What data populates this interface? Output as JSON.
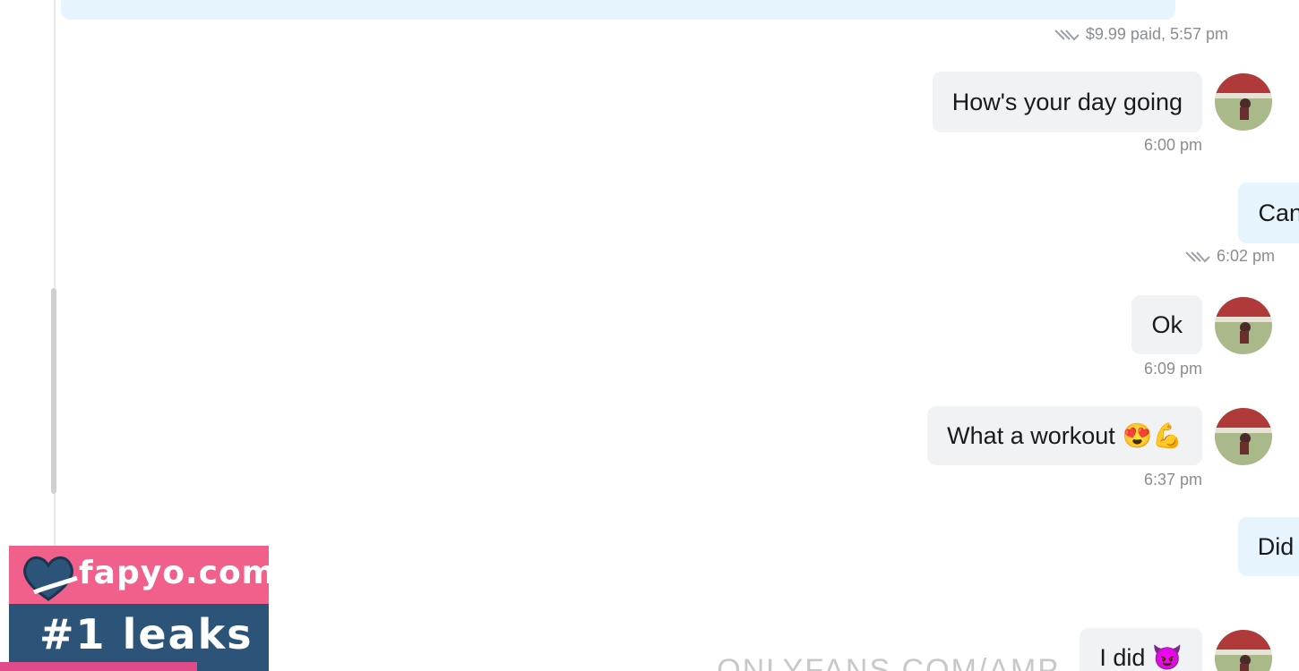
{
  "messages": [
    {
      "id": "m0",
      "side": "out",
      "text": "",
      "time": "$9.99 paid, 5:57 pm"
    },
    {
      "id": "m1",
      "side": "in",
      "text": "How's your day going",
      "time": "6:00 pm"
    },
    {
      "id": "m2",
      "side": "out",
      "text": "Can't wait for you to see this new video!",
      "emoji": "👆",
      "time": "6:02 pm"
    },
    {
      "id": "m3",
      "side": "in",
      "text": "Ok",
      "time": "6:09 pm"
    },
    {
      "id": "m4",
      "side": "in",
      "text": "What a workout",
      "emoji": "😍💪",
      "time": "6:37 pm"
    },
    {
      "id": "m5",
      "side": "out",
      "text": "Did you enjoy it",
      "emoji": "😏?",
      "time": ""
    },
    {
      "id": "m6",
      "side": "in",
      "text": "I did",
      "emoji": "😈",
      "time": ""
    }
  ],
  "watermark": {
    "domain": "fapyo.com",
    "tagline": "#1 leaks",
    "background_text": "ONLYFANS.COM/AMP..."
  },
  "colors": {
    "incoming_bubble": "#f0f2f4",
    "outgoing_bubble": "#e6f5fd",
    "watermark_pink": "#f0608a",
    "watermark_blue": "#2b5478"
  }
}
